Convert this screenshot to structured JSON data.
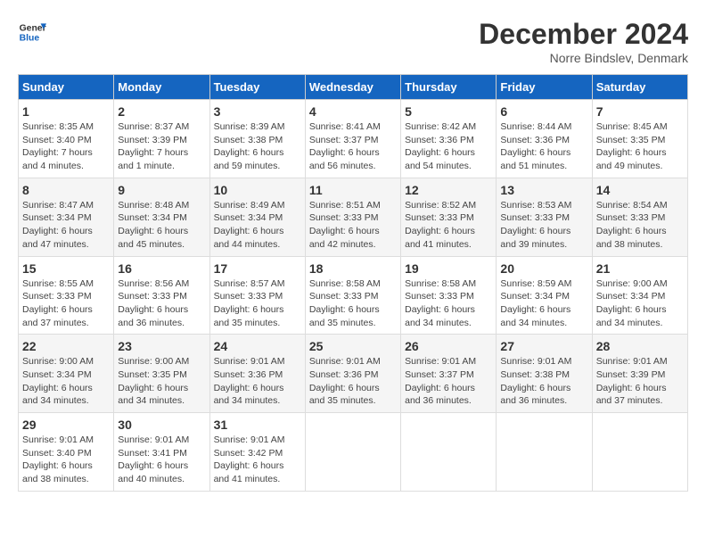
{
  "header": {
    "logo_line1": "General",
    "logo_line2": "Blue",
    "title": "December 2024",
    "location": "Norre Bindslev, Denmark"
  },
  "weekdays": [
    "Sunday",
    "Monday",
    "Tuesday",
    "Wednesday",
    "Thursday",
    "Friday",
    "Saturday"
  ],
  "weeks": [
    [
      {
        "day": "1",
        "sunrise": "8:35 AM",
        "sunset": "3:40 PM",
        "daylight": "7 hours and 4 minutes."
      },
      {
        "day": "2",
        "sunrise": "8:37 AM",
        "sunset": "3:39 PM",
        "daylight": "7 hours and 1 minute."
      },
      {
        "day": "3",
        "sunrise": "8:39 AM",
        "sunset": "3:38 PM",
        "daylight": "6 hours and 59 minutes."
      },
      {
        "day": "4",
        "sunrise": "8:41 AM",
        "sunset": "3:37 PM",
        "daylight": "6 hours and 56 minutes."
      },
      {
        "day": "5",
        "sunrise": "8:42 AM",
        "sunset": "3:36 PM",
        "daylight": "6 hours and 54 minutes."
      },
      {
        "day": "6",
        "sunrise": "8:44 AM",
        "sunset": "3:36 PM",
        "daylight": "6 hours and 51 minutes."
      },
      {
        "day": "7",
        "sunrise": "8:45 AM",
        "sunset": "3:35 PM",
        "daylight": "6 hours and 49 minutes."
      }
    ],
    [
      {
        "day": "8",
        "sunrise": "8:47 AM",
        "sunset": "3:34 PM",
        "daylight": "6 hours and 47 minutes."
      },
      {
        "day": "9",
        "sunrise": "8:48 AM",
        "sunset": "3:34 PM",
        "daylight": "6 hours and 45 minutes."
      },
      {
        "day": "10",
        "sunrise": "8:49 AM",
        "sunset": "3:34 PM",
        "daylight": "6 hours and 44 minutes."
      },
      {
        "day": "11",
        "sunrise": "8:51 AM",
        "sunset": "3:33 PM",
        "daylight": "6 hours and 42 minutes."
      },
      {
        "day": "12",
        "sunrise": "8:52 AM",
        "sunset": "3:33 PM",
        "daylight": "6 hours and 41 minutes."
      },
      {
        "day": "13",
        "sunrise": "8:53 AM",
        "sunset": "3:33 PM",
        "daylight": "6 hours and 39 minutes."
      },
      {
        "day": "14",
        "sunrise": "8:54 AM",
        "sunset": "3:33 PM",
        "daylight": "6 hours and 38 minutes."
      }
    ],
    [
      {
        "day": "15",
        "sunrise": "8:55 AM",
        "sunset": "3:33 PM",
        "daylight": "6 hours and 37 minutes."
      },
      {
        "day": "16",
        "sunrise": "8:56 AM",
        "sunset": "3:33 PM",
        "daylight": "6 hours and 36 minutes."
      },
      {
        "day": "17",
        "sunrise": "8:57 AM",
        "sunset": "3:33 PM",
        "daylight": "6 hours and 35 minutes."
      },
      {
        "day": "18",
        "sunrise": "8:58 AM",
        "sunset": "3:33 PM",
        "daylight": "6 hours and 35 minutes."
      },
      {
        "day": "19",
        "sunrise": "8:58 AM",
        "sunset": "3:33 PM",
        "daylight": "6 hours and 34 minutes."
      },
      {
        "day": "20",
        "sunrise": "8:59 AM",
        "sunset": "3:34 PM",
        "daylight": "6 hours and 34 minutes."
      },
      {
        "day": "21",
        "sunrise": "9:00 AM",
        "sunset": "3:34 PM",
        "daylight": "6 hours and 34 minutes."
      }
    ],
    [
      {
        "day": "22",
        "sunrise": "9:00 AM",
        "sunset": "3:34 PM",
        "daylight": "6 hours and 34 minutes."
      },
      {
        "day": "23",
        "sunrise": "9:00 AM",
        "sunset": "3:35 PM",
        "daylight": "6 hours and 34 minutes."
      },
      {
        "day": "24",
        "sunrise": "9:01 AM",
        "sunset": "3:36 PM",
        "daylight": "6 hours and 34 minutes."
      },
      {
        "day": "25",
        "sunrise": "9:01 AM",
        "sunset": "3:36 PM",
        "daylight": "6 hours and 35 minutes."
      },
      {
        "day": "26",
        "sunrise": "9:01 AM",
        "sunset": "3:37 PM",
        "daylight": "6 hours and 36 minutes."
      },
      {
        "day": "27",
        "sunrise": "9:01 AM",
        "sunset": "3:38 PM",
        "daylight": "6 hours and 36 minutes."
      },
      {
        "day": "28",
        "sunrise": "9:01 AM",
        "sunset": "3:39 PM",
        "daylight": "6 hours and 37 minutes."
      }
    ],
    [
      {
        "day": "29",
        "sunrise": "9:01 AM",
        "sunset": "3:40 PM",
        "daylight": "6 hours and 38 minutes."
      },
      {
        "day": "30",
        "sunrise": "9:01 AM",
        "sunset": "3:41 PM",
        "daylight": "6 hours and 40 minutes."
      },
      {
        "day": "31",
        "sunrise": "9:01 AM",
        "sunset": "3:42 PM",
        "daylight": "6 hours and 41 minutes."
      },
      null,
      null,
      null,
      null
    ]
  ]
}
